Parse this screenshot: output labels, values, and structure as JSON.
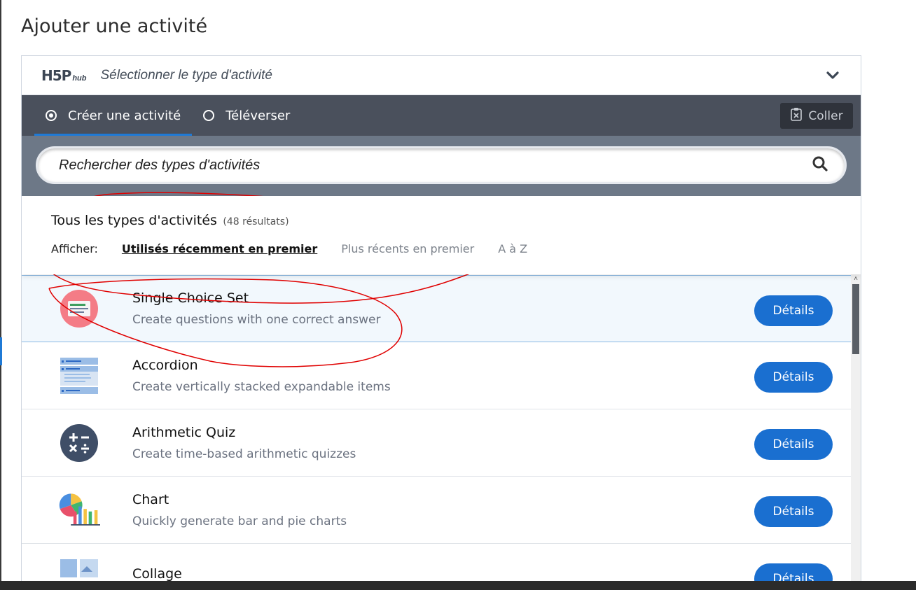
{
  "page": {
    "title": "Ajouter une activité"
  },
  "hub": {
    "logo_text": "H5P",
    "logo_sub": "hub",
    "header_title": "Sélectionner le type d'activité",
    "tabs": [
      {
        "label": "Créer une activité",
        "selected": true
      },
      {
        "label": "Téléverser",
        "selected": false
      }
    ],
    "paste_label": "Coller",
    "search": {
      "placeholder": "Rechercher des types d'activités",
      "value": ""
    },
    "results": {
      "title": "Tous les types d'activités",
      "count": "(48 résultats)",
      "sort_label": "Afficher:",
      "sort_options": [
        "Utilisés récemment en premier",
        "Plus récents en premier",
        "A à Z"
      ],
      "sort_active": "Utilisés récemment en premier"
    },
    "items": [
      {
        "title": "Single Choice Set",
        "desc": "Create questions with one correct answer",
        "button": "Détails",
        "icon": "single-choice-set-icon"
      },
      {
        "title": "Accordion",
        "desc": "Create vertically stacked expandable items",
        "button": "Détails",
        "icon": "accordion-icon"
      },
      {
        "title": "Arithmetic Quiz",
        "desc": "Create time-based arithmetic quizzes",
        "button": "Détails",
        "icon": "arithmetic-quiz-icon"
      },
      {
        "title": "Chart",
        "desc": "Quickly generate bar and pie charts",
        "button": "Détails",
        "icon": "chart-icon"
      },
      {
        "title": "Collage",
        "desc": "",
        "button": "Détails",
        "icon": "collage-icon"
      }
    ]
  },
  "colors": {
    "accent": "#1a6fd0",
    "tabs_bg": "#4a505c",
    "search_bg": "#6d7887",
    "annotation": "#e00000"
  }
}
